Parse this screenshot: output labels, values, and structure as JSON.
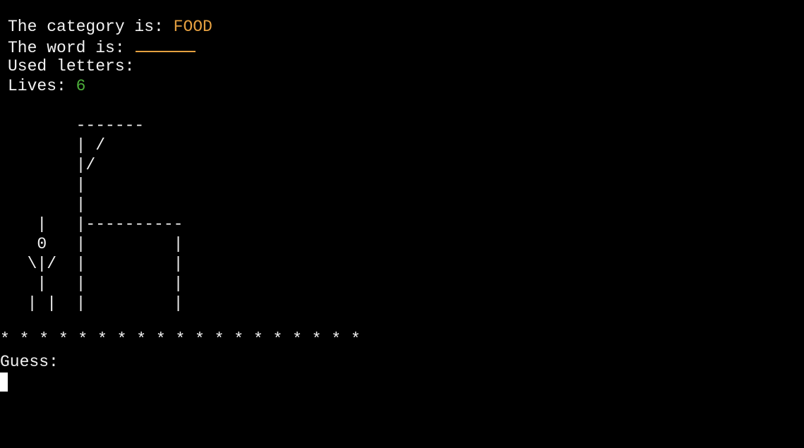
{
  "status": {
    "category_label": "The category is: ",
    "category_value": "FOOD",
    "word_label": "The word is: ",
    "used_letters_label": "Used letters:",
    "used_letters_value": "",
    "lives_label": "Lives: ",
    "lives_value": "6"
  },
  "hangman_art": "       -------\n       | /\n       |/\n       |\n       |\n   |   |----------\n   0   |         |\n  \\|/  |         |\n   |   |         |\n  | |  |         |",
  "separator": "* * * * * * * * * * * * * * * * * * *",
  "prompt": {
    "label": "Guess:",
    "input_value": ""
  },
  "colors": {
    "background": "#000000",
    "text": "#f2f2f2",
    "category_accent": "#e5a040",
    "lives_accent": "#4cae3a"
  }
}
